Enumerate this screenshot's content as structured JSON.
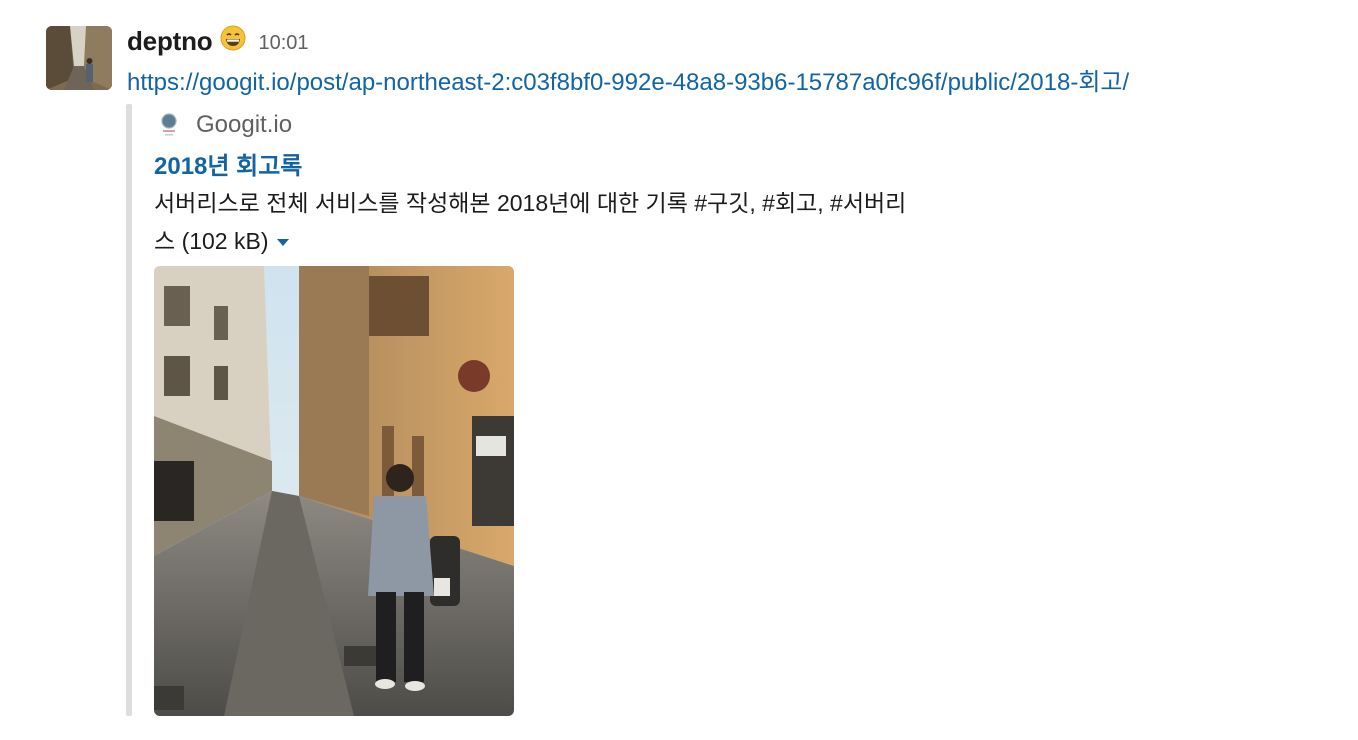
{
  "message": {
    "username": "deptno",
    "status_emoji": "grinning-face",
    "timestamp": "10:01",
    "link_url": "https://googit.io/post/ap-northeast-2:c03f8bf0-992e-48a8-93b6-15787a0fc96f/public/2018-회고/"
  },
  "attachment": {
    "service_name": "Googit.io",
    "service_icon": "googit-favicon",
    "title": "2018년 회고록",
    "description_line1": "서버리스로 전체 서비스를 작성해본 2018년에 대한 기록 #구깃, #회고, #서버리",
    "description_line2": "스",
    "file_size": "(102 kB)",
    "expand_icon": "caret-down",
    "image_alt": "street-photo",
    "colors": {
      "link": "#1264a3",
      "bar": "#dddddd",
      "muted": "#616061"
    }
  }
}
